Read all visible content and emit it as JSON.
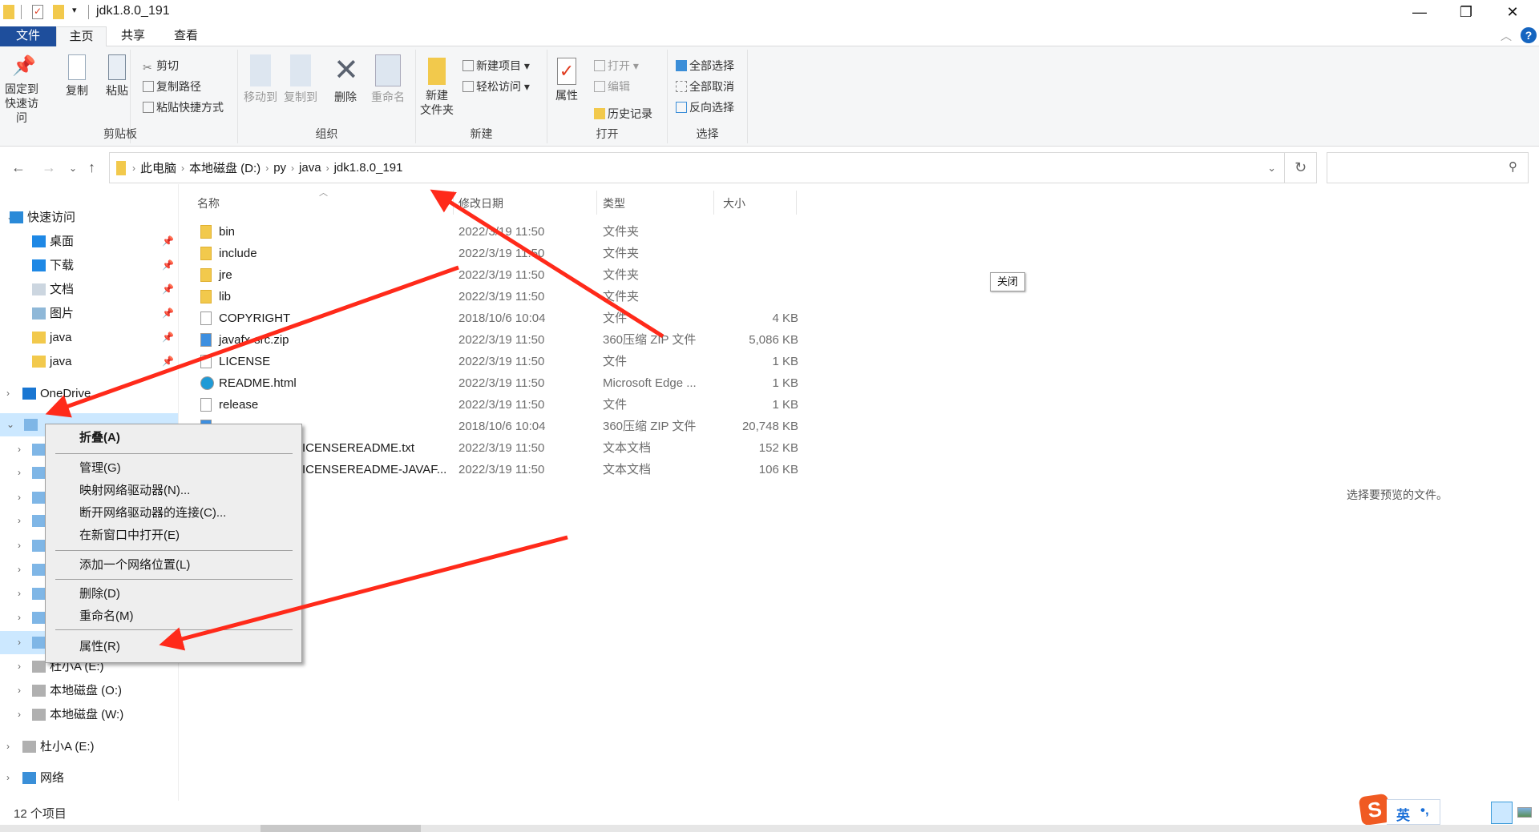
{
  "window": {
    "title": "jdk1.8.0_191",
    "controls": {
      "minimize": "—",
      "restore": "❐",
      "close": "✕"
    }
  },
  "tabs": [
    {
      "label": "文件"
    },
    {
      "label": "主页"
    },
    {
      "label": "共享"
    },
    {
      "label": "查看"
    }
  ],
  "ribbon": {
    "clipboard": {
      "label": "剪贴板",
      "pin": "固定到\n快速访问",
      "pin1": "固定到",
      "pin2": "快速访问",
      "copy": "复制",
      "paste": "粘贴",
      "cut": "剪切",
      "copy_path": "复制路径",
      "paste_shortcut": "粘贴快捷方式"
    },
    "organize": {
      "label": "组织",
      "move_to": "移动到",
      "copy_to": "复制到",
      "delete": "删除",
      "rename": "重命名"
    },
    "new": {
      "label": "新建",
      "new_folder1": "新建",
      "new_folder2": "文件夹",
      "new_item": "新建项目",
      "easy_access": "轻松访问"
    },
    "open": {
      "label": "打开",
      "properties": "属性",
      "open": "打开",
      "edit": "编辑",
      "history": "历史记录"
    },
    "select": {
      "label": "选择",
      "select_all": "全部选择",
      "select_none": "全部取消",
      "invert": "反向选择"
    }
  },
  "address": {
    "crumbs": [
      "此电脑",
      "本地磁盘 (D:)",
      "py",
      "java",
      "jdk1.8.0_191"
    ],
    "search_placeholder": ""
  },
  "nav": {
    "items": [
      {
        "label": "快速访问",
        "icon": "star-icon"
      },
      {
        "label": "桌面",
        "icon": "desktop-icon"
      },
      {
        "label": "下载",
        "icon": "download-icon"
      },
      {
        "label": "文档",
        "icon": "document-icon"
      },
      {
        "label": "图片",
        "icon": "pictures-icon"
      },
      {
        "label": "java",
        "icon": "folder-icon"
      },
      {
        "label": "java",
        "icon": "folder-icon"
      },
      {
        "label": "OneDrive",
        "icon": "onedrive-icon"
      },
      {
        "label": "",
        "icon": "computer-icon"
      },
      {
        "label": "杜小A (E:)",
        "icon": "drive-icon"
      },
      {
        "label": "本地磁盘 (O:)",
        "icon": "drive-icon"
      },
      {
        "label": "本地磁盘 (W:)",
        "icon": "drive-icon"
      },
      {
        "label": "杜小A (E:)",
        "icon": "drive-icon"
      },
      {
        "label": "网络",
        "icon": "network-icon"
      }
    ]
  },
  "columns": {
    "name": "名称",
    "date": "修改日期",
    "type": "类型",
    "size": "大小"
  },
  "files": [
    {
      "name": "bin",
      "date": "2022/3/19 11:50",
      "type": "文件夹",
      "size": "",
      "icon": "folder"
    },
    {
      "name": "include",
      "date": "2022/3/19 11:50",
      "type": "文件夹",
      "size": "",
      "icon": "folder"
    },
    {
      "name": "jre",
      "date": "2022/3/19 11:50",
      "type": "文件夹",
      "size": "",
      "icon": "folder"
    },
    {
      "name": "lib",
      "date": "2022/3/19 11:50",
      "type": "文件夹",
      "size": "",
      "icon": "folder"
    },
    {
      "name": "COPYRIGHT",
      "date": "2018/10/6 10:04",
      "type": "文件",
      "size": "4 KB",
      "icon": "file"
    },
    {
      "name": "javafx-src.zip",
      "date": "2022/3/19 11:50",
      "type": "360压缩 ZIP 文件",
      "size": "5,086 KB",
      "icon": "zip"
    },
    {
      "name": "LICENSE",
      "date": "2022/3/19 11:50",
      "type": "文件",
      "size": "1 KB",
      "icon": "file"
    },
    {
      "name": "README.html",
      "date": "2022/3/19 11:50",
      "type": "Microsoft Edge ...",
      "size": "1 KB",
      "icon": "edge"
    },
    {
      "name": "release",
      "date": "2022/3/19 11:50",
      "type": "文件",
      "size": "1 KB",
      "icon": "file"
    },
    {
      "name": "",
      "date": "2018/10/6 10:04",
      "type": "360压缩 ZIP 文件",
      "size": "20,748 KB",
      "icon": "zip"
    },
    {
      "name": "ICENSEREADME.txt",
      "date": "2022/3/19 11:50",
      "type": "文本文档",
      "size": "152 KB",
      "icon": "txt"
    },
    {
      "name": "ICENSEREADME-JAVAF...",
      "date": "2022/3/19 11:50",
      "type": "文本文档",
      "size": "106 KB",
      "icon": "txt"
    }
  ],
  "context_menu": {
    "items": [
      "折叠(A)",
      "管理(G)",
      "映射网络驱动器(N)...",
      "断开网络驱动器的连接(C)...",
      "在新窗口中打开(E)",
      "添加一个网络位置(L)",
      "删除(D)",
      "重命名(M)",
      "属性(R)"
    ]
  },
  "close_tooltip": "关闭",
  "preview_text": "选择要预览的文件。",
  "status": {
    "count": "12 个项目"
  },
  "ime": {
    "mode": "英",
    "punct": "•,"
  },
  "colors": {
    "file_tab": "#1e4e9c",
    "selection": "#cce8ff",
    "annotation_arrow": "#ff2a1a",
    "ribbon_bg": "#f5f6f7"
  }
}
